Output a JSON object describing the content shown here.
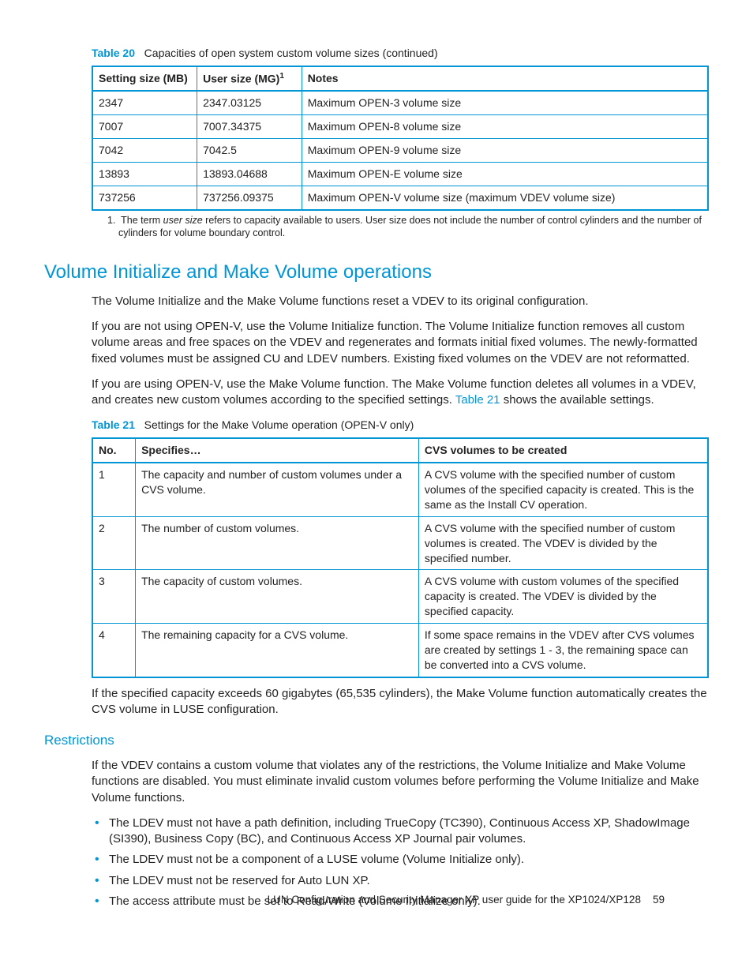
{
  "table20": {
    "label": "Table 20",
    "caption": "Capacities of open system custom volume sizes (continued)",
    "headers": {
      "c0": "Setting size (MB)",
      "c1": "User size (MG)",
      "c1_sup": "1",
      "c2": "Notes"
    },
    "rows": [
      {
        "c0": "2347",
        "c1": "2347.03125",
        "c2": "Maximum OPEN-3 volume size"
      },
      {
        "c0": "7007",
        "c1": "7007.34375",
        "c2": "Maximum OPEN-8 volume size"
      },
      {
        "c0": "7042",
        "c1": "7042.5",
        "c2": "Maximum OPEN-9 volume size"
      },
      {
        "c0": "13893",
        "c1": "13893.04688",
        "c2": "Maximum OPEN-E volume size"
      },
      {
        "c0": "737256",
        "c1": "737256.09375",
        "c2": "Maximum OPEN-V volume size (maximum VDEV volume size)"
      }
    ],
    "footnote_num": "1.",
    "footnote_a": "The term ",
    "footnote_em": "user size",
    "footnote_b": " refers to capacity available to users. User size does not include the number of control cylinders and the number of cylinders for volume boundary control."
  },
  "h2_vol_init": "Volume Initialize and Make Volume operations",
  "p_vol1": "The Volume Initialize and the Make Volume functions reset a VDEV to its original configuration.",
  "p_vol2": "If you are not using OPEN-V, use the Volume Initialize function. The Volume Initialize function removes all custom volume areas and free spaces on the VDEV and regenerates and formats initial fixed volumes. The newly-formatted fixed volumes must be assigned CU and LDEV numbers. Existing fixed volumes on the VDEV are not reformatted.",
  "p_vol3a": "If you are using OPEN-V, use the Make Volume function. The Make Volume function deletes all volumes in a VDEV, and creates new custom volumes according to the specified settings. ",
  "p_vol3_link": "Table 21",
  "p_vol3b": " shows the available settings.",
  "table21": {
    "label": "Table 21",
    "caption": "Settings for the Make Volume operation (OPEN-V only)",
    "headers": {
      "c0": "No.",
      "c1": "Specifies…",
      "c2": "CVS volumes to be created"
    },
    "rows": [
      {
        "c0": "1",
        "c1": "The capacity and number of custom volumes under a CVS volume.",
        "c2": "A CVS volume with the specified number of custom volumes of the specified capacity is created. This is the same as the Install CV operation."
      },
      {
        "c0": "2",
        "c1": "The number of custom volumes.",
        "c2": "A CVS volume with the specified number of custom volumes is created. The VDEV is divided by the specified number."
      },
      {
        "c0": "3",
        "c1": "The capacity of custom volumes.",
        "c2": "A CVS volume with custom volumes of the specified capacity is created. The VDEV is divided by the specified capacity."
      },
      {
        "c0": "4",
        "c1": "The remaining capacity for a CVS volume.",
        "c2": "If some space remains in the VDEV after CVS volumes are created by settings 1 - 3, the remaining space can be converted into a CVS volume."
      }
    ]
  },
  "p_after_t21": "If the specified capacity exceeds 60 gigabytes (65,535 cylinders), the Make Volume function automatically creates the CVS volume in LUSE configuration.",
  "h3_restrictions": "Restrictions",
  "p_restr": "If the VDEV contains a custom volume that violates any of the restrictions, the Volume Initialize and Make Volume functions are disabled. You must eliminate invalid custom volumes before performing the Volume Initialize and Make Volume functions.",
  "bullets": [
    "The LDEV must not have a path definition, including TrueCopy (TC390), Continuous Access XP, ShadowImage (SI390), Business Copy (BC), and Continuous Access XP Journal pair volumes.",
    "The LDEV must not be a component of a LUSE volume (Volume Initialize only).",
    "The LDEV must not be reserved for Auto LUN XP.",
    "The access attribute must be set to Read/Write (Volume Initialize only)."
  ],
  "footer_text": "LUN Configuration and Security Manager XP user guide for the XP1024/XP128",
  "footer_page": "59"
}
